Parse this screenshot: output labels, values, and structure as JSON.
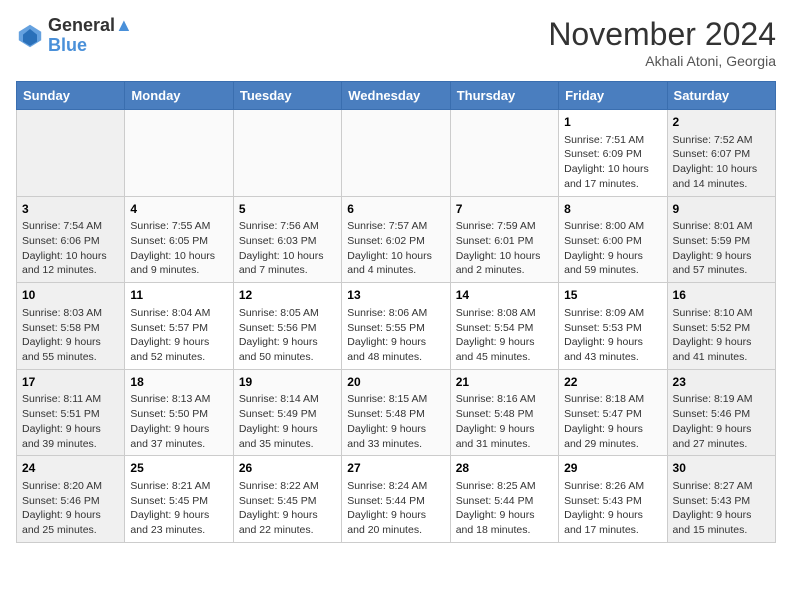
{
  "header": {
    "logo_line1": "General",
    "logo_line2": "Blue",
    "month": "November 2024",
    "location": "Akhali Atoni, Georgia"
  },
  "weekdays": [
    "Sunday",
    "Monday",
    "Tuesday",
    "Wednesday",
    "Thursday",
    "Friday",
    "Saturday"
  ],
  "weeks": [
    [
      {
        "day": "",
        "info": ""
      },
      {
        "day": "",
        "info": ""
      },
      {
        "day": "",
        "info": ""
      },
      {
        "day": "",
        "info": ""
      },
      {
        "day": "",
        "info": ""
      },
      {
        "day": "1",
        "info": "Sunrise: 7:51 AM\nSunset: 6:09 PM\nDaylight: 10 hours and 17 minutes."
      },
      {
        "day": "2",
        "info": "Sunrise: 7:52 AM\nSunset: 6:07 PM\nDaylight: 10 hours and 14 minutes."
      }
    ],
    [
      {
        "day": "3",
        "info": "Sunrise: 7:54 AM\nSunset: 6:06 PM\nDaylight: 10 hours and 12 minutes."
      },
      {
        "day": "4",
        "info": "Sunrise: 7:55 AM\nSunset: 6:05 PM\nDaylight: 10 hours and 9 minutes."
      },
      {
        "day": "5",
        "info": "Sunrise: 7:56 AM\nSunset: 6:03 PM\nDaylight: 10 hours and 7 minutes."
      },
      {
        "day": "6",
        "info": "Sunrise: 7:57 AM\nSunset: 6:02 PM\nDaylight: 10 hours and 4 minutes."
      },
      {
        "day": "7",
        "info": "Sunrise: 7:59 AM\nSunset: 6:01 PM\nDaylight: 10 hours and 2 minutes."
      },
      {
        "day": "8",
        "info": "Sunrise: 8:00 AM\nSunset: 6:00 PM\nDaylight: 9 hours and 59 minutes."
      },
      {
        "day": "9",
        "info": "Sunrise: 8:01 AM\nSunset: 5:59 PM\nDaylight: 9 hours and 57 minutes."
      }
    ],
    [
      {
        "day": "10",
        "info": "Sunrise: 8:03 AM\nSunset: 5:58 PM\nDaylight: 9 hours and 55 minutes."
      },
      {
        "day": "11",
        "info": "Sunrise: 8:04 AM\nSunset: 5:57 PM\nDaylight: 9 hours and 52 minutes."
      },
      {
        "day": "12",
        "info": "Sunrise: 8:05 AM\nSunset: 5:56 PM\nDaylight: 9 hours and 50 minutes."
      },
      {
        "day": "13",
        "info": "Sunrise: 8:06 AM\nSunset: 5:55 PM\nDaylight: 9 hours and 48 minutes."
      },
      {
        "day": "14",
        "info": "Sunrise: 8:08 AM\nSunset: 5:54 PM\nDaylight: 9 hours and 45 minutes."
      },
      {
        "day": "15",
        "info": "Sunrise: 8:09 AM\nSunset: 5:53 PM\nDaylight: 9 hours and 43 minutes."
      },
      {
        "day": "16",
        "info": "Sunrise: 8:10 AM\nSunset: 5:52 PM\nDaylight: 9 hours and 41 minutes."
      }
    ],
    [
      {
        "day": "17",
        "info": "Sunrise: 8:11 AM\nSunset: 5:51 PM\nDaylight: 9 hours and 39 minutes."
      },
      {
        "day": "18",
        "info": "Sunrise: 8:13 AM\nSunset: 5:50 PM\nDaylight: 9 hours and 37 minutes."
      },
      {
        "day": "19",
        "info": "Sunrise: 8:14 AM\nSunset: 5:49 PM\nDaylight: 9 hours and 35 minutes."
      },
      {
        "day": "20",
        "info": "Sunrise: 8:15 AM\nSunset: 5:48 PM\nDaylight: 9 hours and 33 minutes."
      },
      {
        "day": "21",
        "info": "Sunrise: 8:16 AM\nSunset: 5:48 PM\nDaylight: 9 hours and 31 minutes."
      },
      {
        "day": "22",
        "info": "Sunrise: 8:18 AM\nSunset: 5:47 PM\nDaylight: 9 hours and 29 minutes."
      },
      {
        "day": "23",
        "info": "Sunrise: 8:19 AM\nSunset: 5:46 PM\nDaylight: 9 hours and 27 minutes."
      }
    ],
    [
      {
        "day": "24",
        "info": "Sunrise: 8:20 AM\nSunset: 5:46 PM\nDaylight: 9 hours and 25 minutes."
      },
      {
        "day": "25",
        "info": "Sunrise: 8:21 AM\nSunset: 5:45 PM\nDaylight: 9 hours and 23 minutes."
      },
      {
        "day": "26",
        "info": "Sunrise: 8:22 AM\nSunset: 5:45 PM\nDaylight: 9 hours and 22 minutes."
      },
      {
        "day": "27",
        "info": "Sunrise: 8:24 AM\nSunset: 5:44 PM\nDaylight: 9 hours and 20 minutes."
      },
      {
        "day": "28",
        "info": "Sunrise: 8:25 AM\nSunset: 5:44 PM\nDaylight: 9 hours and 18 minutes."
      },
      {
        "day": "29",
        "info": "Sunrise: 8:26 AM\nSunset: 5:43 PM\nDaylight: 9 hours and 17 minutes."
      },
      {
        "day": "30",
        "info": "Sunrise: 8:27 AM\nSunset: 5:43 PM\nDaylight: 9 hours and 15 minutes."
      }
    ]
  ]
}
